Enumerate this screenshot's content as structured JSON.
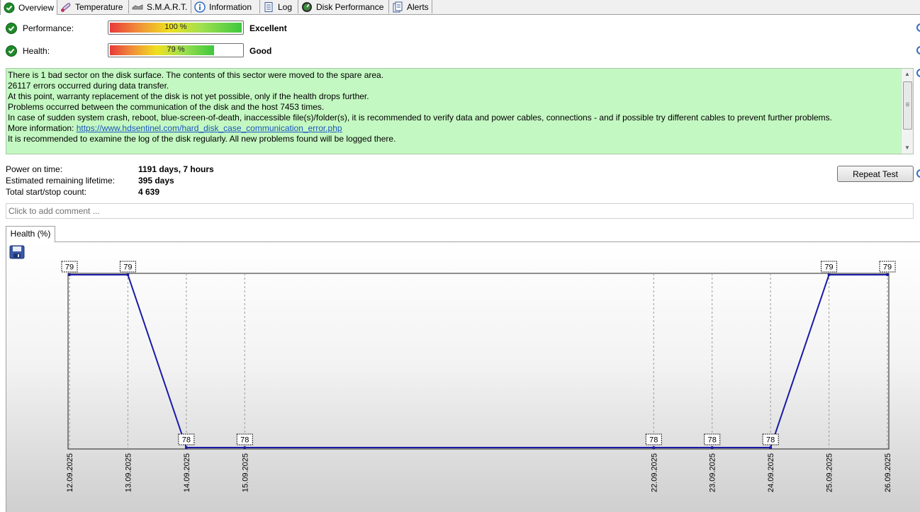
{
  "tabs": [
    {
      "label": "Overview",
      "icon": "check-circle-icon",
      "active": true
    },
    {
      "label": "Temperature",
      "icon": "thermometer-icon",
      "active": false
    },
    {
      "label": "S.M.A.R.T.",
      "icon": "smart-icon",
      "active": false
    },
    {
      "label": "Information",
      "icon": "info-icon",
      "active": false
    },
    {
      "label": "Log",
      "icon": "log-icon",
      "active": false
    },
    {
      "label": "Disk Performance",
      "icon": "gauge-icon",
      "active": false
    },
    {
      "label": "Alerts",
      "icon": "alerts-icon",
      "active": false
    }
  ],
  "status": {
    "performance": {
      "label": "Performance:",
      "percent": 100,
      "percent_text": "100 %",
      "rating": "Excellent"
    },
    "health": {
      "label": "Health:",
      "percent": 79,
      "percent_text": "79 %",
      "rating": "Good"
    }
  },
  "message": {
    "lines": [
      "There is 1 bad sector on the disk surface. The contents of this sector were moved to the spare area.",
      "26117 errors occurred during data transfer.",
      "At this point, warranty replacement of the disk is not yet possible, only if the health drops further.",
      "Problems occurred between the communication of the disk and the host 7453 times.",
      "In case of sudden system crash, reboot, blue-screen-of-death, inaccessible file(s)/folder(s), it is recommended to verify data and power cables, connections - and if possible try different cables to prevent further problems."
    ],
    "more_info_label": "More information: ",
    "more_info_link": "https://www.hdsentinel.com/hard_disk_case_communication_error.php",
    "last_line": "It is recommended to examine the log of the disk regularly. All new problems found will be logged there."
  },
  "stats": {
    "power_on_label": "Power on time:",
    "power_on_value": "1191 days, 7 hours",
    "lifetime_label": "Estimated remaining lifetime:",
    "lifetime_value": "395 days",
    "startstop_label": "Total start/stop count:",
    "startstop_value": "4 639"
  },
  "repeat_button": "Repeat Test",
  "comment_placeholder": "Click to add comment ...",
  "chart_tab": "Health (%)",
  "colors": {
    "line": "#1a1aa8",
    "message_bg": "#c4f8c2",
    "ok_green": "#1f8a2a"
  },
  "chart_data": {
    "type": "line",
    "xlabel": "",
    "ylabel": "",
    "ylim": [
      78,
      79
    ],
    "grid": true,
    "x": [
      "12.09.2025",
      "13.09.2025",
      "14.09.2025",
      "15.09.2025",
      "22.09.2025",
      "23.09.2025",
      "24.09.2025",
      "25.09.2025",
      "26.09.2025"
    ],
    "series": [
      {
        "values": [
          79,
          79,
          78,
          78,
          78,
          78,
          78,
          79,
          79
        ]
      }
    ]
  }
}
